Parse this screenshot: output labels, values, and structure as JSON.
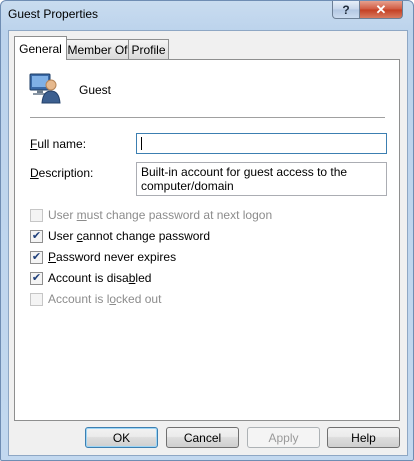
{
  "window": {
    "title": "Guest Properties",
    "help_glyph": "?",
    "close_glyph": "✕"
  },
  "tabs": [
    {
      "label": "General",
      "active": true
    },
    {
      "label": "Member Of",
      "active": false
    },
    {
      "label": "Profile",
      "active": false
    }
  ],
  "general": {
    "user_icon": "user-icon",
    "user_name": "Guest",
    "full_name": {
      "label_pre": "",
      "label_accel": "F",
      "label_post": "ull name:",
      "value": ""
    },
    "description": {
      "label_pre": "",
      "label_accel": "D",
      "label_post": "escription:",
      "value": "Built-in account for guest access to the computer/domain"
    },
    "checkboxes": [
      {
        "pre": "User ",
        "accel": "m",
        "post": "ust change password at next logon",
        "checked": false,
        "enabled": false
      },
      {
        "pre": "User ",
        "accel": "c",
        "post": "annot change password",
        "checked": true,
        "enabled": true
      },
      {
        "pre": "",
        "accel": "P",
        "post": "assword never expires",
        "checked": true,
        "enabled": true
      },
      {
        "pre": "Account is disa",
        "accel": "b",
        "post": "led",
        "checked": true,
        "enabled": true
      },
      {
        "pre": "Account is l",
        "accel": "o",
        "post": "cked out",
        "checked": false,
        "enabled": false
      }
    ]
  },
  "buttons": {
    "ok": "OK",
    "cancel": "Cancel",
    "apply": "Apply",
    "help": "Help"
  },
  "colors": {
    "title_bar": "#bcd3ec",
    "close_button": "#c33e22",
    "focus_border": "#3c7fb1",
    "check_mark": "#1e3f7a"
  }
}
